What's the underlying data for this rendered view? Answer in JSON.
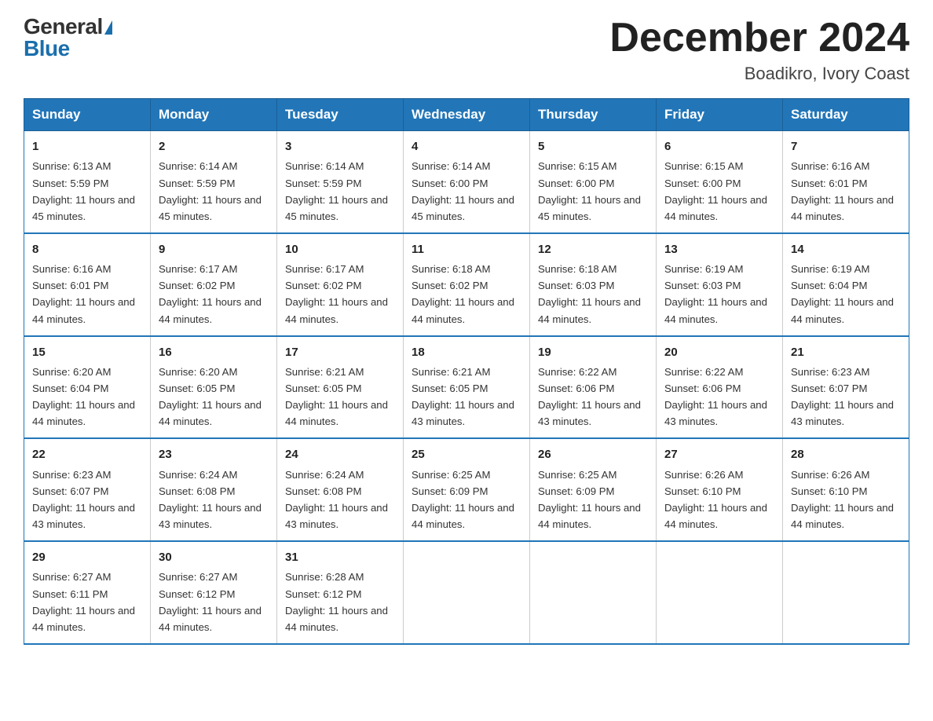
{
  "header": {
    "logo_general": "General",
    "logo_blue": "Blue",
    "title": "December 2024",
    "subtitle": "Boadikro, Ivory Coast"
  },
  "days_of_week": [
    "Sunday",
    "Monday",
    "Tuesday",
    "Wednesday",
    "Thursday",
    "Friday",
    "Saturday"
  ],
  "weeks": [
    [
      {
        "day": "1",
        "sunrise": "Sunrise: 6:13 AM",
        "sunset": "Sunset: 5:59 PM",
        "daylight": "Daylight: 11 hours and 45 minutes."
      },
      {
        "day": "2",
        "sunrise": "Sunrise: 6:14 AM",
        "sunset": "Sunset: 5:59 PM",
        "daylight": "Daylight: 11 hours and 45 minutes."
      },
      {
        "day": "3",
        "sunrise": "Sunrise: 6:14 AM",
        "sunset": "Sunset: 5:59 PM",
        "daylight": "Daylight: 11 hours and 45 minutes."
      },
      {
        "day": "4",
        "sunrise": "Sunrise: 6:14 AM",
        "sunset": "Sunset: 6:00 PM",
        "daylight": "Daylight: 11 hours and 45 minutes."
      },
      {
        "day": "5",
        "sunrise": "Sunrise: 6:15 AM",
        "sunset": "Sunset: 6:00 PM",
        "daylight": "Daylight: 11 hours and 45 minutes."
      },
      {
        "day": "6",
        "sunrise": "Sunrise: 6:15 AM",
        "sunset": "Sunset: 6:00 PM",
        "daylight": "Daylight: 11 hours and 44 minutes."
      },
      {
        "day": "7",
        "sunrise": "Sunrise: 6:16 AM",
        "sunset": "Sunset: 6:01 PM",
        "daylight": "Daylight: 11 hours and 44 minutes."
      }
    ],
    [
      {
        "day": "8",
        "sunrise": "Sunrise: 6:16 AM",
        "sunset": "Sunset: 6:01 PM",
        "daylight": "Daylight: 11 hours and 44 minutes."
      },
      {
        "day": "9",
        "sunrise": "Sunrise: 6:17 AM",
        "sunset": "Sunset: 6:02 PM",
        "daylight": "Daylight: 11 hours and 44 minutes."
      },
      {
        "day": "10",
        "sunrise": "Sunrise: 6:17 AM",
        "sunset": "Sunset: 6:02 PM",
        "daylight": "Daylight: 11 hours and 44 minutes."
      },
      {
        "day": "11",
        "sunrise": "Sunrise: 6:18 AM",
        "sunset": "Sunset: 6:02 PM",
        "daylight": "Daylight: 11 hours and 44 minutes."
      },
      {
        "day": "12",
        "sunrise": "Sunrise: 6:18 AM",
        "sunset": "Sunset: 6:03 PM",
        "daylight": "Daylight: 11 hours and 44 minutes."
      },
      {
        "day": "13",
        "sunrise": "Sunrise: 6:19 AM",
        "sunset": "Sunset: 6:03 PM",
        "daylight": "Daylight: 11 hours and 44 minutes."
      },
      {
        "day": "14",
        "sunrise": "Sunrise: 6:19 AM",
        "sunset": "Sunset: 6:04 PM",
        "daylight": "Daylight: 11 hours and 44 minutes."
      }
    ],
    [
      {
        "day": "15",
        "sunrise": "Sunrise: 6:20 AM",
        "sunset": "Sunset: 6:04 PM",
        "daylight": "Daylight: 11 hours and 44 minutes."
      },
      {
        "day": "16",
        "sunrise": "Sunrise: 6:20 AM",
        "sunset": "Sunset: 6:05 PM",
        "daylight": "Daylight: 11 hours and 44 minutes."
      },
      {
        "day": "17",
        "sunrise": "Sunrise: 6:21 AM",
        "sunset": "Sunset: 6:05 PM",
        "daylight": "Daylight: 11 hours and 44 minutes."
      },
      {
        "day": "18",
        "sunrise": "Sunrise: 6:21 AM",
        "sunset": "Sunset: 6:05 PM",
        "daylight": "Daylight: 11 hours and 43 minutes."
      },
      {
        "day": "19",
        "sunrise": "Sunrise: 6:22 AM",
        "sunset": "Sunset: 6:06 PM",
        "daylight": "Daylight: 11 hours and 43 minutes."
      },
      {
        "day": "20",
        "sunrise": "Sunrise: 6:22 AM",
        "sunset": "Sunset: 6:06 PM",
        "daylight": "Daylight: 11 hours and 43 minutes."
      },
      {
        "day": "21",
        "sunrise": "Sunrise: 6:23 AM",
        "sunset": "Sunset: 6:07 PM",
        "daylight": "Daylight: 11 hours and 43 minutes."
      }
    ],
    [
      {
        "day": "22",
        "sunrise": "Sunrise: 6:23 AM",
        "sunset": "Sunset: 6:07 PM",
        "daylight": "Daylight: 11 hours and 43 minutes."
      },
      {
        "day": "23",
        "sunrise": "Sunrise: 6:24 AM",
        "sunset": "Sunset: 6:08 PM",
        "daylight": "Daylight: 11 hours and 43 minutes."
      },
      {
        "day": "24",
        "sunrise": "Sunrise: 6:24 AM",
        "sunset": "Sunset: 6:08 PM",
        "daylight": "Daylight: 11 hours and 43 minutes."
      },
      {
        "day": "25",
        "sunrise": "Sunrise: 6:25 AM",
        "sunset": "Sunset: 6:09 PM",
        "daylight": "Daylight: 11 hours and 44 minutes."
      },
      {
        "day": "26",
        "sunrise": "Sunrise: 6:25 AM",
        "sunset": "Sunset: 6:09 PM",
        "daylight": "Daylight: 11 hours and 44 minutes."
      },
      {
        "day": "27",
        "sunrise": "Sunrise: 6:26 AM",
        "sunset": "Sunset: 6:10 PM",
        "daylight": "Daylight: 11 hours and 44 minutes."
      },
      {
        "day": "28",
        "sunrise": "Sunrise: 6:26 AM",
        "sunset": "Sunset: 6:10 PM",
        "daylight": "Daylight: 11 hours and 44 minutes."
      }
    ],
    [
      {
        "day": "29",
        "sunrise": "Sunrise: 6:27 AM",
        "sunset": "Sunset: 6:11 PM",
        "daylight": "Daylight: 11 hours and 44 minutes."
      },
      {
        "day": "30",
        "sunrise": "Sunrise: 6:27 AM",
        "sunset": "Sunset: 6:12 PM",
        "daylight": "Daylight: 11 hours and 44 minutes."
      },
      {
        "day": "31",
        "sunrise": "Sunrise: 6:28 AM",
        "sunset": "Sunset: 6:12 PM",
        "daylight": "Daylight: 11 hours and 44 minutes."
      },
      null,
      null,
      null,
      null
    ]
  ]
}
